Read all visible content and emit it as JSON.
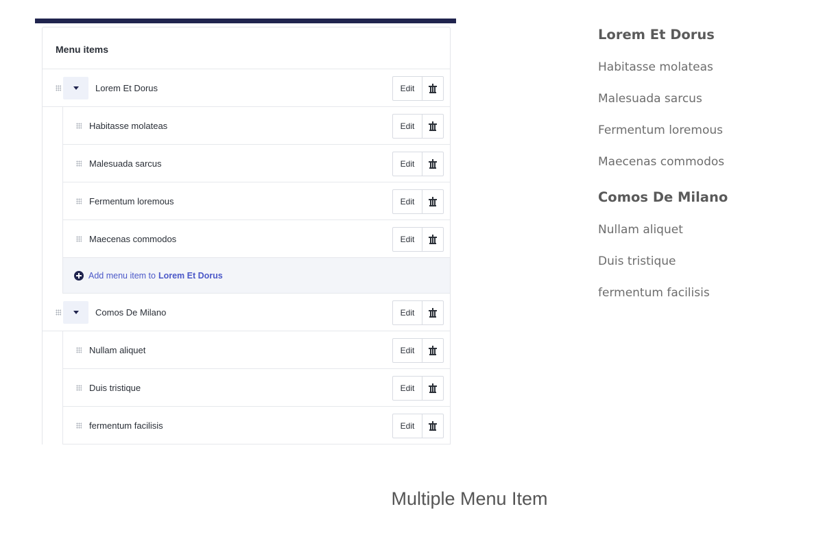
{
  "panel": {
    "header_title": "Menu items",
    "edit_label": "Edit",
    "add_prefix": "Add menu item to",
    "groups": [
      {
        "title": "Lorem Et Dorus",
        "children": [
          "Habitasse molateas",
          "Malesuada sarcus",
          "Fermentum loremous",
          "Maecenas commodos"
        ]
      },
      {
        "title": "Comos De Milano",
        "children": [
          "Nullam aliquet",
          "Duis tristique",
          "fermentum facilisis"
        ]
      }
    ]
  },
  "preview": {
    "groups": [
      {
        "title": "Lorem Et Dorus",
        "items": [
          "Habitasse molateas",
          "Malesuada sarcus",
          "Fermentum loremous",
          "Maecenas commodos"
        ]
      },
      {
        "title": "Comos De Milano",
        "items": [
          "Nullam aliquet",
          "Duis tristique",
          "fermentum facilisis"
        ]
      }
    ]
  },
  "caption": "Multiple Menu Item",
  "colors": {
    "top_bar": "#20244e",
    "accent_link": "#4b58c8",
    "caret_button_bg": "#eef1f9"
  },
  "icons": {
    "drag_handle": "drag-handle-icon",
    "caret": "caret-down-icon",
    "trash": "trash-icon",
    "add": "plus-circle-icon"
  }
}
